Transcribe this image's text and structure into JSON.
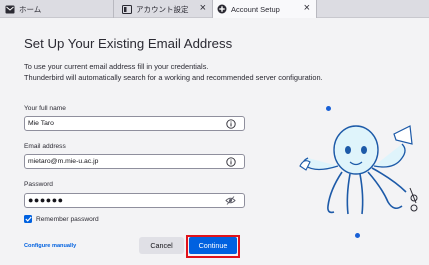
{
  "tabs": [
    {
      "label": "ホーム",
      "icon": "home-mail-icon"
    },
    {
      "label": "アカウント設定",
      "icon": "account-settings-icon",
      "close": "×"
    },
    {
      "label": "Account Setup",
      "icon": "account-setup-icon",
      "close": "×"
    }
  ],
  "setup": {
    "title": "Set Up Your Existing Email Address",
    "intro_line1": "To use your current email address fill in your credentials.",
    "intro_line2": "Thunderbird will automatically search for a working and recommended server configuration.",
    "full_name": {
      "label": "Your full name",
      "value": "Mie Taro"
    },
    "email": {
      "label": "Email address",
      "value": "mietaro@m.mie-u.ac.jp"
    },
    "password": {
      "label": "Password",
      "value": "●●●●●●"
    },
    "remember_label": "Remember password",
    "remember_checked": true,
    "configure_manually": "Configure manually",
    "cancel": "Cancel",
    "continue": "Continue"
  },
  "colors": {
    "accent": "#0061e0",
    "highlight_outline": "#e0121b"
  }
}
